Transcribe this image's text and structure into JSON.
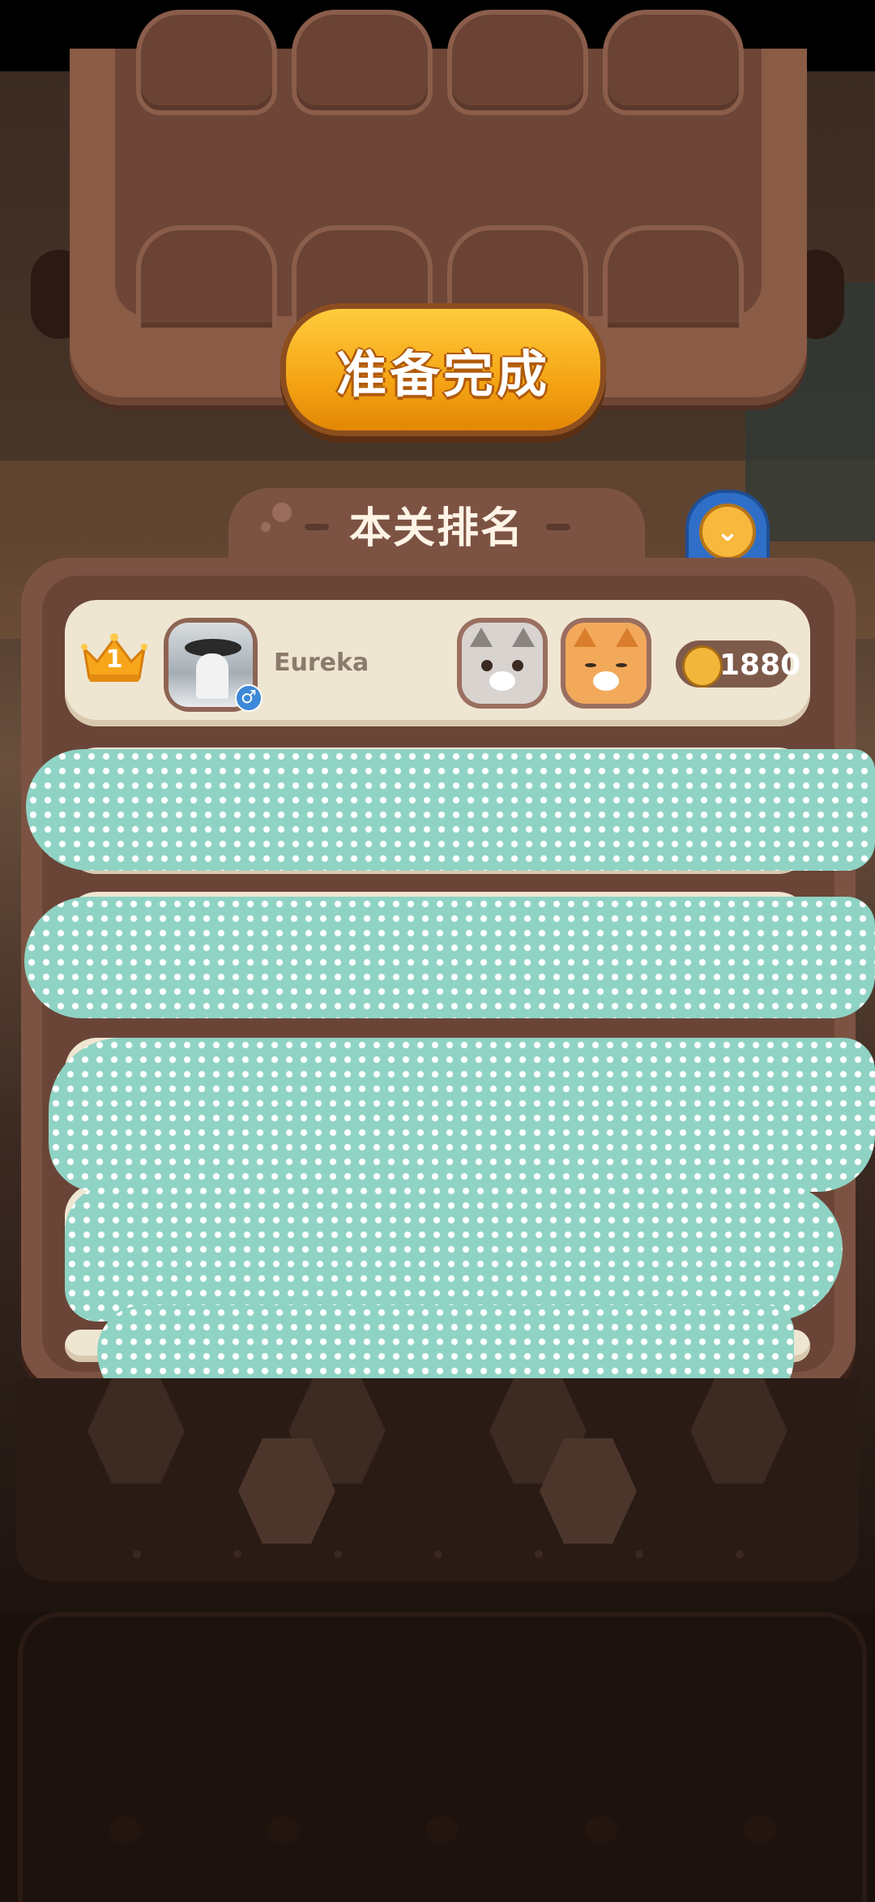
{
  "colors": {
    "panel_brown": "#7c5343",
    "row_cream": "#efe6d2",
    "ready_orange": "#f5a414",
    "redaction_teal": "#8fd3c5",
    "collapse_blue": "#2f6fc8"
  },
  "ready_button": {
    "label": "准备完成"
  },
  "ranking": {
    "title": "本关排名",
    "collapse_icon": "chevron-down-icon",
    "rows": [
      {
        "rank": "1",
        "rank_icon": "crown-icon",
        "username": "Eureka",
        "gender_icon": "male-icon",
        "pets": [
          "gray-cat-icon",
          "orange-cat-icon"
        ],
        "coins": "1880",
        "coin_icon": "coffee-bean-coin-icon"
      }
    ],
    "redacted_rows": 5
  }
}
